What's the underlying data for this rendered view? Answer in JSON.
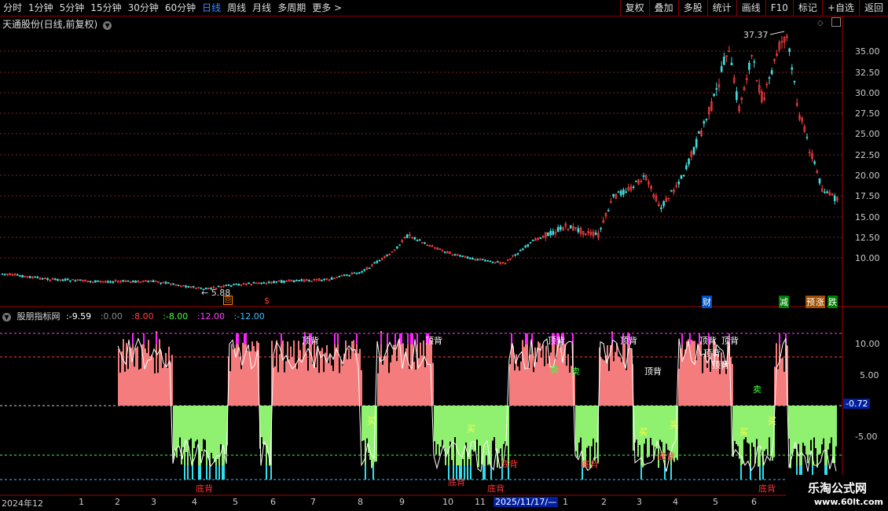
{
  "toolbar": {
    "periods": [
      "分时",
      "1分钟",
      "5分钟",
      "15分钟",
      "30分钟",
      "60分钟",
      "日线",
      "周线",
      "月线",
      "多周期",
      "更多"
    ],
    "active_period": "日线",
    "buttons": [
      "复权",
      "叠加",
      "多股",
      "统计",
      "画线",
      "F10",
      "标记",
      "+自选",
      "返回"
    ]
  },
  "stock": {
    "title": "天通股份(日线,前复权)"
  },
  "price_axis": [
    "35.00",
    "32.50",
    "30.00",
    "27.50",
    "25.00",
    "22.50",
    "20.00",
    "17.50",
    "15.00",
    "12.50",
    "10.00"
  ],
  "price_annotations": {
    "high": "37.37",
    "low": "5.88"
  },
  "event_markers": [
    "财",
    "减",
    "预",
    "涨",
    "跌"
  ],
  "indicator": {
    "name": "股朋指标网",
    "values": [
      "-9.59",
      "0.00",
      "8.00",
      "-8.00",
      "12.00",
      "-12.00"
    ],
    "colors": [
      "#ffffff",
      "#888888",
      "#ff4040",
      "#40ff40",
      "#ff40ff",
      "#40c0ff"
    ],
    "axis": [
      "10.00",
      "5.00",
      "-5.00"
    ],
    "current_value": "-0.72",
    "signal_labels": {
      "top": "顶背",
      "bottom": "底背",
      "sell": "卖",
      "buy": "买"
    }
  },
  "date_axis": {
    "labels": [
      "2024年12",
      "1",
      "2",
      "3",
      "4",
      "5",
      "6",
      "7",
      "8",
      "9",
      "10",
      "11",
      "2025/11/17/—",
      "1",
      "2",
      "3",
      "4",
      "5",
      "6"
    ],
    "cursor_date": "2025/11/17/—"
  },
  "watermark": {
    "name": "乐淘公式网",
    "url": "www.60lt.com"
  },
  "colors": {
    "up": "#ff4040",
    "down": "#40e0e0",
    "background": "#000000",
    "positive_fill": "#f47c7c",
    "negative_fill": "#90f070"
  }
}
